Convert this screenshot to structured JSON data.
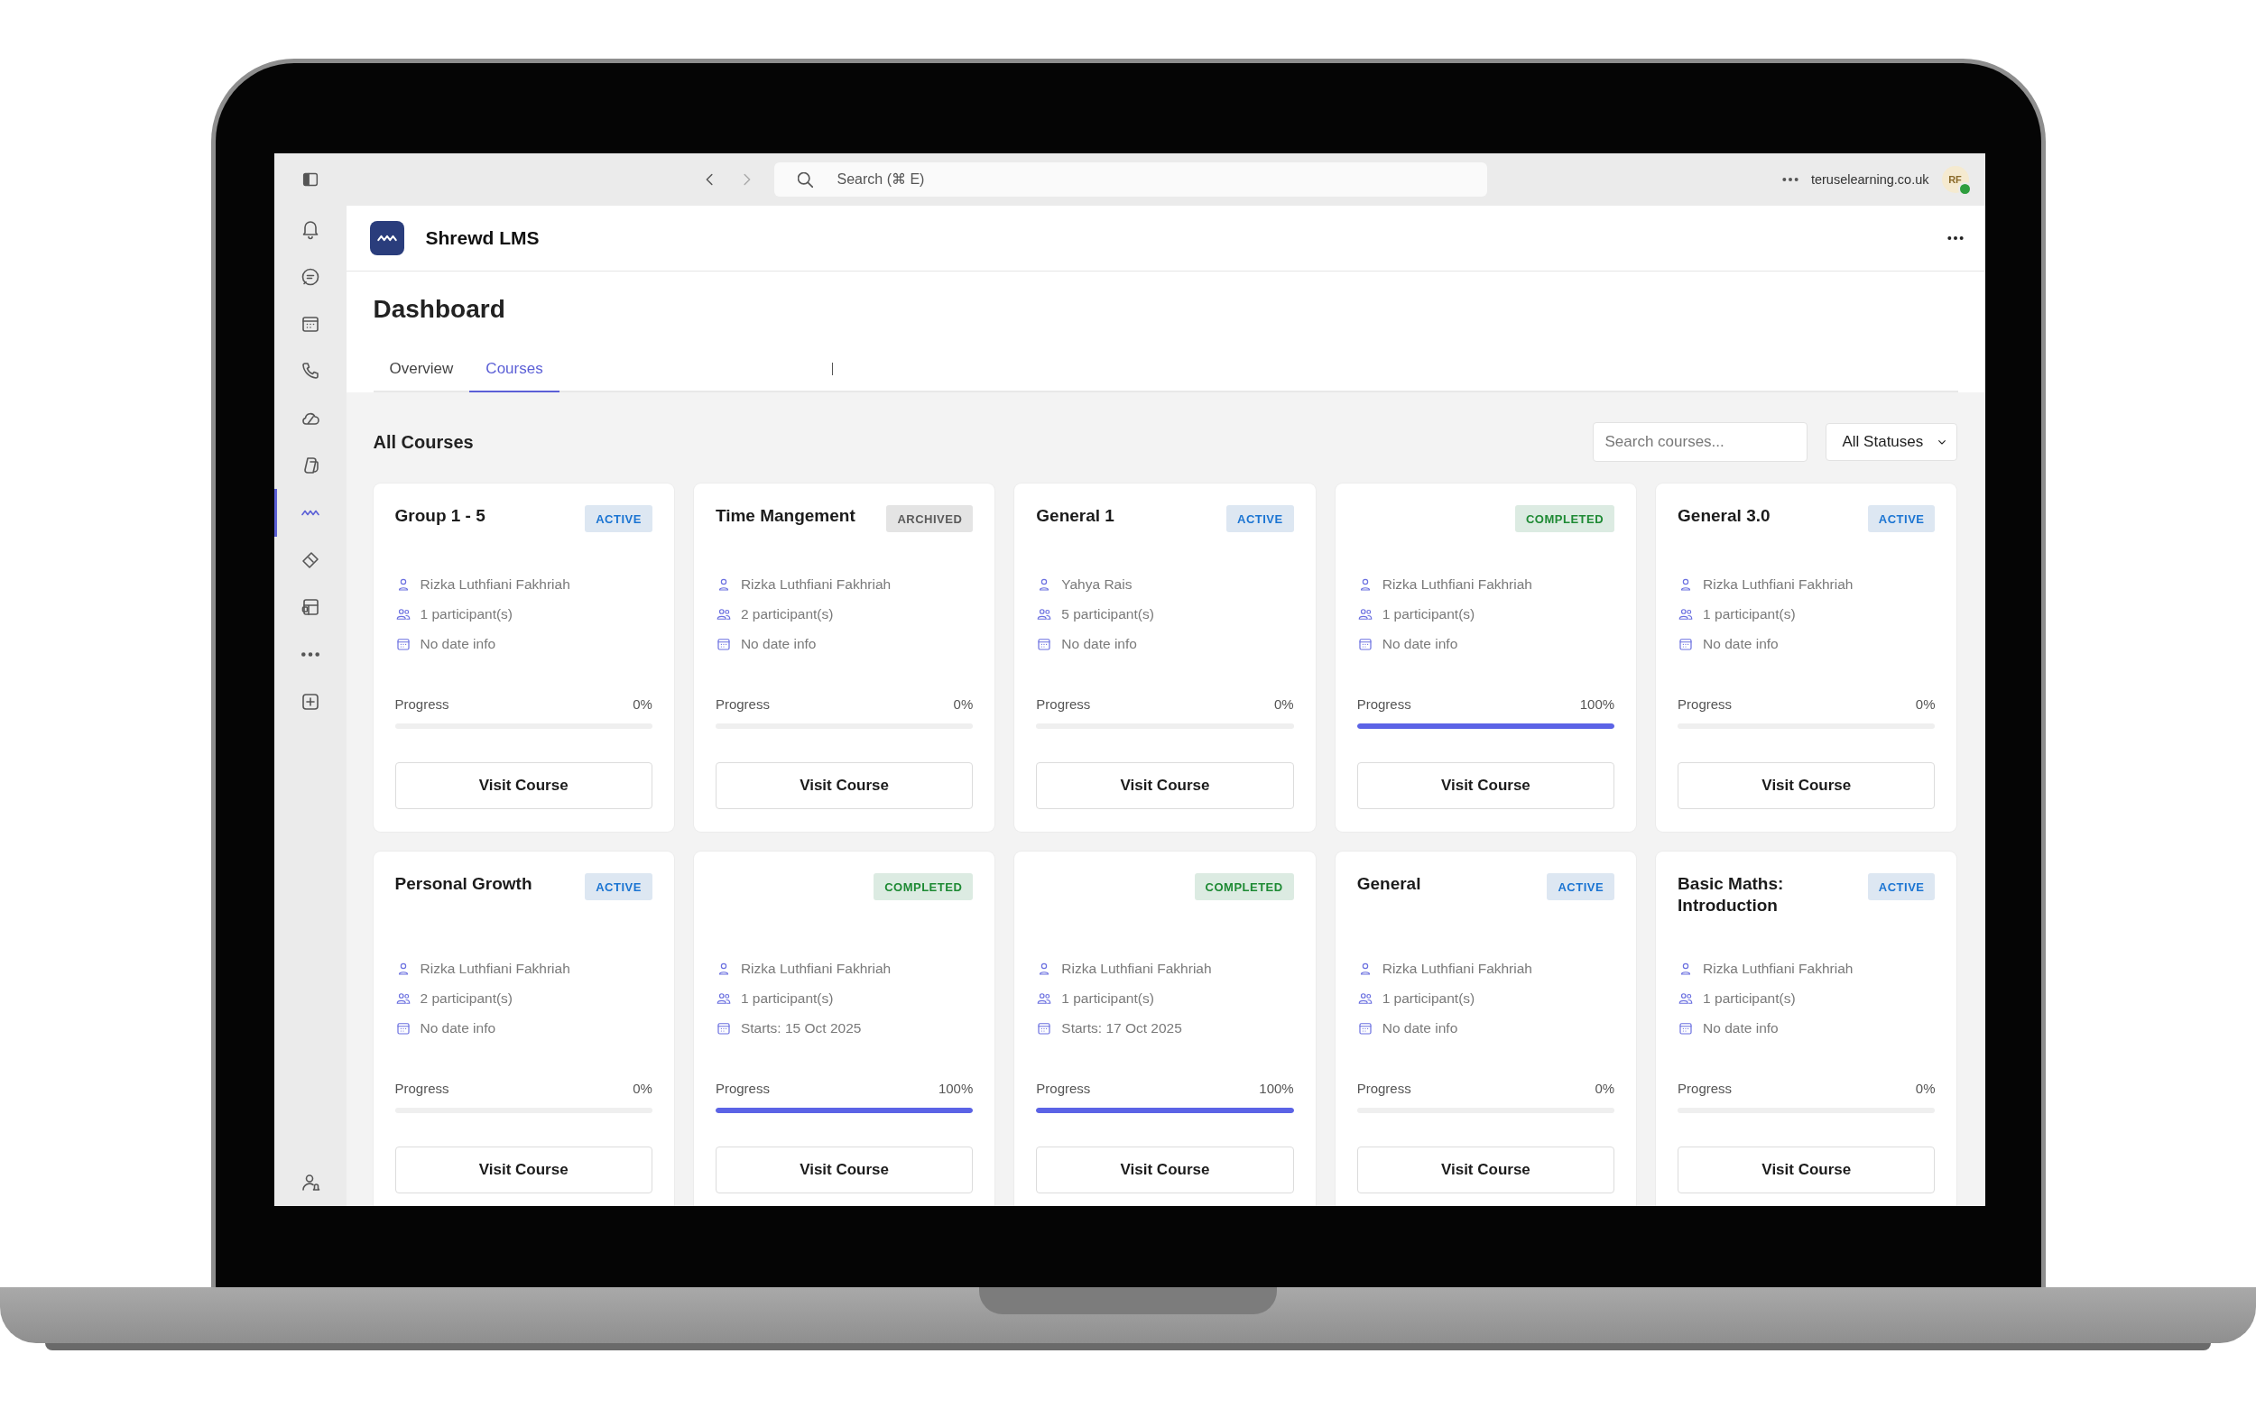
{
  "top_bar": {
    "search": {
      "placeholder": "Search (⌘ E)"
    },
    "domain": "teruselearning.co.uk",
    "avatar": {
      "initials": "RF"
    }
  },
  "rail": {
    "items": [
      {
        "kind": "bell",
        "selected": false
      },
      {
        "kind": "chat",
        "selected": false
      },
      {
        "kind": "calendar",
        "selected": false
      },
      {
        "kind": "phone",
        "selected": false
      },
      {
        "kind": "cloud",
        "selected": false
      },
      {
        "kind": "copilot",
        "selected": false
      },
      {
        "kind": "app",
        "selected": true
      },
      {
        "kind": "tag",
        "selected": false
      },
      {
        "kind": "layout",
        "selected": false
      },
      {
        "kind": "more",
        "selected": false
      },
      {
        "kind": "add",
        "selected": false
      }
    ],
    "bottom_items": [
      {
        "kind": "person",
        "selected": false
      }
    ]
  },
  "app": {
    "title": "Shrewd LMS"
  },
  "page_title": "Dashboard",
  "tabs": [
    {
      "label": "Overview",
      "selected": false
    },
    {
      "label": "Courses",
      "selected": true
    }
  ],
  "courses_section": {
    "heading": "All Courses",
    "search": {
      "placeholder": "Search courses..."
    },
    "status_filter": {
      "value": "All Statuses"
    }
  },
  "courses": [
    {
      "title": "Group 1 - 5",
      "status": {
        "label": "ACTIVE",
        "kind": "active"
      },
      "instructor": "Rizka Luthfiani Fakhriah",
      "participants": "1 participant(s)",
      "dates": "No date info",
      "progress_label": "Progress",
      "progress_text": "0%",
      "level": 0,
      "button": "Visit Course"
    },
    {
      "title": "Time Mangement",
      "status": {
        "label": "ARCHIVED",
        "kind": "archived"
      },
      "instructor": "Rizka Luthfiani Fakhriah",
      "participants": "2 participant(s)",
      "dates": "No date info",
      "progress_label": "Progress",
      "progress_text": "0%",
      "level": 0,
      "button": "Visit Course"
    },
    {
      "title": "General 1",
      "status": {
        "label": "ACTIVE",
        "kind": "active"
      },
      "instructor": "Yahya Rais",
      "participants": "5 participant(s)",
      "dates": "No date info",
      "progress_label": "Progress",
      "progress_text": "0%",
      "level": 0,
      "button": "Visit Course"
    },
    {
      "status": {
        "label": "COMPLETED",
        "kind": "completed"
      },
      "instructor": "Rizka Luthfiani Fakhriah",
      "participants": "1 participant(s)",
      "dates": "No date info",
      "progress_label": "Progress",
      "progress_text": "100%",
      "level": 1,
      "button": "Visit Course"
    },
    {
      "title": "General 3.0",
      "status": {
        "label": "ACTIVE",
        "kind": "active"
      },
      "instructor": "Rizka Luthfiani Fakhriah",
      "participants": "1 participant(s)",
      "dates": "No date info",
      "progress_label": "Progress",
      "progress_text": "0%",
      "level": 0,
      "button": "Visit Course"
    },
    {
      "title": "Personal Growth",
      "status": {
        "label": "ACTIVE",
        "kind": "active"
      },
      "instructor": "Rizka Luthfiani Fakhriah",
      "participants": "2 participant(s)",
      "dates": "No date info",
      "progress_label": "Progress",
      "progress_text": "0%",
      "level": 0,
      "button": "Visit Course"
    },
    {
      "status": {
        "label": "COMPLETED",
        "kind": "completed"
      },
      "instructor": "Rizka Luthfiani Fakhriah",
      "participants": "1 participant(s)",
      "dates": "Starts: 15 Oct 2025",
      "progress_label": "Progress",
      "progress_text": "100%",
      "level": 1,
      "button": "Visit Course"
    },
    {
      "status": {
        "label": "COMPLETED",
        "kind": "completed"
      },
      "instructor": "Rizka Luthfiani Fakhriah",
      "participants": "1 participant(s)",
      "dates": "Starts: 17 Oct 2025",
      "progress_label": "Progress",
      "progress_text": "100%",
      "level": 1,
      "button": "Visit Course"
    },
    {
      "title": "General",
      "status": {
        "label": "ACTIVE",
        "kind": "active"
      },
      "instructor": "Rizka Luthfiani Fakhriah",
      "participants": "1 participant(s)",
      "dates": "No date info",
      "progress_label": "Progress",
      "progress_text": "0%",
      "level": 0,
      "button": "Visit Course"
    },
    {
      "title": "Basic Maths: Introduction",
      "status": {
        "label": "ACTIVE",
        "kind": "active"
      },
      "instructor": "Rizka Luthfiani Fakhriah",
      "participants": "1 participant(s)",
      "dates": "No date info",
      "progress_label": "Progress",
      "progress_text": "0%",
      "level": 0,
      "button": "Visit Course"
    }
  ]
}
